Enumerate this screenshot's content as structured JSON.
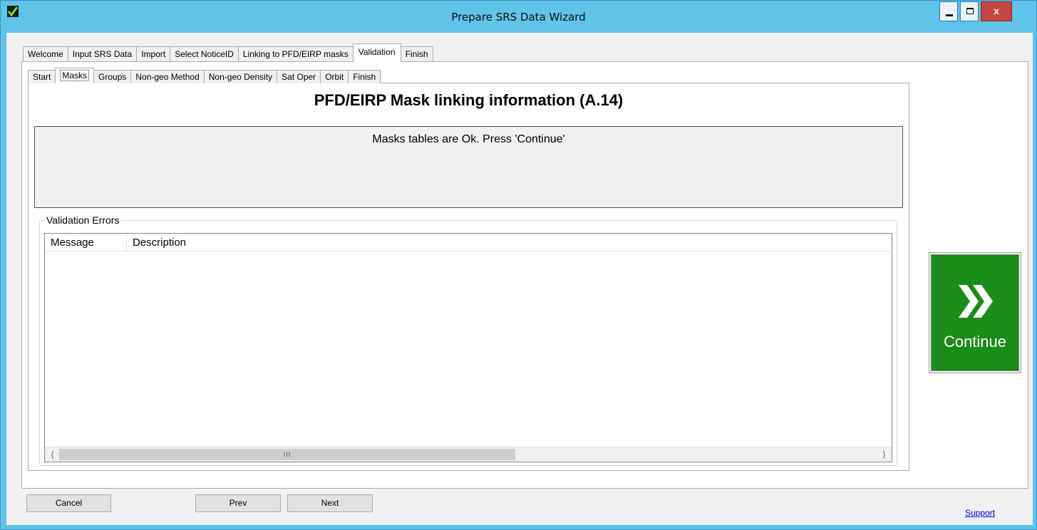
{
  "window": {
    "title": "Prepare SRS Data Wizard",
    "close_glyph": "x"
  },
  "outer_tabs": [
    {
      "label": "Welcome"
    },
    {
      "label": "Input SRS Data"
    },
    {
      "label": "Import"
    },
    {
      "label": "Select NoticeID"
    },
    {
      "label": "Linking to PFD/EIRP masks"
    },
    {
      "label": "Validation",
      "active": true
    },
    {
      "label": "Finish"
    }
  ],
  "inner_tabs": [
    {
      "label": "Start"
    },
    {
      "label": "Masks",
      "active": true
    },
    {
      "label": "Groups"
    },
    {
      "label": "Non-geo Method"
    },
    {
      "label": "Non-geo Density"
    },
    {
      "label": "Sat Oper"
    },
    {
      "label": "Orbit"
    },
    {
      "label": "Finish"
    }
  ],
  "main": {
    "heading": "PFD/EIRP Mask linking information (A.14)",
    "status_message": "Masks tables are Ok. Press 'Continue'"
  },
  "validation_errors": {
    "group_label": "Validation Errors",
    "columns": [
      "Message",
      "Description"
    ],
    "rows": [],
    "scroll_thumb_glyph": "III"
  },
  "continue_button": {
    "label": "Continue",
    "color": "#1a8c18",
    "icon": "double-chevron-right-icon"
  },
  "footer": {
    "cancel_label": "Cancel",
    "prev_label": "Prev",
    "next_label": "Next",
    "support_link": "Support"
  },
  "colors": {
    "title_bar": "#5fc3ea",
    "close_button": "#c7463f"
  }
}
